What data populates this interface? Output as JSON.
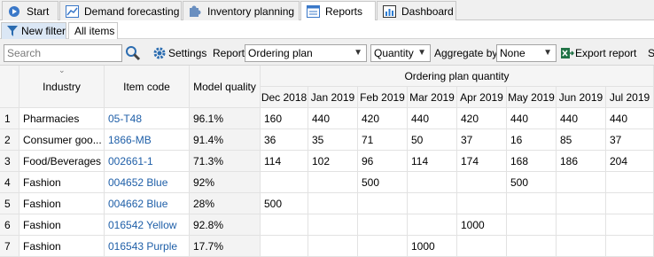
{
  "tabs": [
    {
      "label": "Start",
      "icon": "play-icon"
    },
    {
      "label": "Demand forecasting",
      "icon": "chart-icon"
    },
    {
      "label": "Inventory planning",
      "icon": "puzzle-icon"
    },
    {
      "label": "Reports",
      "icon": "report-icon"
    },
    {
      "label": "Dashboard",
      "icon": "dashboard-icon"
    }
  ],
  "subtabs": {
    "filter_label": "New filter",
    "all_items_label": "All items"
  },
  "toolbar": {
    "search_placeholder": "Search",
    "settings_label": "Settings",
    "report_label": "Report",
    "report_value": "Ordering plan",
    "metric_value": "Quantity",
    "aggregate_label": "Aggregate by",
    "aggregate_value": "None",
    "export_label": "Export report",
    "extra_label": "S"
  },
  "table": {
    "headers": {
      "industry": "Industry",
      "item_code": "Item code",
      "model_quality": "Model quality",
      "group": "Ordering plan quantity"
    },
    "months": [
      "Dec 2018",
      "Jan 2019",
      "Feb 2019",
      "Mar 2019",
      "Apr 2019",
      "May 2019",
      "Jun 2019",
      "Jul 2019"
    ],
    "rows": [
      {
        "num": "1",
        "industry": "Pharmacies",
        "code": "05-T48",
        "quality": "96.1%",
        "values": [
          "160",
          "440",
          "420",
          "440",
          "420",
          "440",
          "440",
          "440"
        ]
      },
      {
        "num": "2",
        "industry": "Consumer goo...",
        "code": "1866-MB",
        "quality": "91.4%",
        "values": [
          "36",
          "35",
          "71",
          "50",
          "37",
          "16",
          "85",
          "37"
        ]
      },
      {
        "num": "3",
        "industry": "Food/Beverages",
        "code": "002661-1",
        "quality": "71.3%",
        "values": [
          "114",
          "102",
          "96",
          "114",
          "174",
          "168",
          "186",
          "204"
        ]
      },
      {
        "num": "4",
        "industry": "Fashion",
        "code": "004652 Blue",
        "quality": "92%",
        "values": [
          "",
          "",
          "500",
          "",
          "",
          "500",
          "",
          ""
        ]
      },
      {
        "num": "5",
        "industry": "Fashion",
        "code": "004662 Blue",
        "quality": "28%",
        "values": [
          "500",
          "",
          "",
          "",
          "",
          "",
          "",
          ""
        ]
      },
      {
        "num": "6",
        "industry": "Fashion",
        "code": "016542 Yellow",
        "quality": "92.8%",
        "values": [
          "",
          "",
          "",
          "",
          "1000",
          "",
          "",
          ""
        ]
      },
      {
        "num": "7",
        "industry": "Fashion",
        "code": "016543 Purple",
        "quality": "17.7%",
        "values": [
          "",
          "",
          "",
          "1000",
          "",
          "",
          "",
          ""
        ]
      }
    ]
  },
  "colors": {
    "link": "#1f5fa8",
    "header_bg": "#f5f5f5",
    "toolbar_bg": "#f0f0f0"
  }
}
